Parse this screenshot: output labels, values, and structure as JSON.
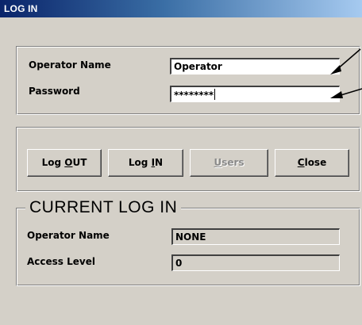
{
  "window": {
    "title": "LOG IN"
  },
  "login": {
    "operator_name_label": "Operator Name",
    "operator_name_value": "Operator",
    "password_label": "Password",
    "password_value": "********"
  },
  "buttons": {
    "logout": {
      "pre": "Log ",
      "mnemonic": "O",
      "post": "UT"
    },
    "login": {
      "pre": "Log ",
      "mnemonic": "I",
      "post": "N"
    },
    "users": {
      "pre": "",
      "mnemonic": "U",
      "post": "sers",
      "enabled": false
    },
    "close": {
      "pre": "",
      "mnemonic": "C",
      "post": "lose"
    }
  },
  "current": {
    "heading": "CURRENT LOG IN",
    "operator_name_label": "Operator Name",
    "operator_name_value": "NONE",
    "access_level_label": "Access Level",
    "access_level_value": "0"
  },
  "colors": {
    "face": "#d4d0c8",
    "title_start": "#0a246a",
    "title_end": "#a6caf0"
  }
}
